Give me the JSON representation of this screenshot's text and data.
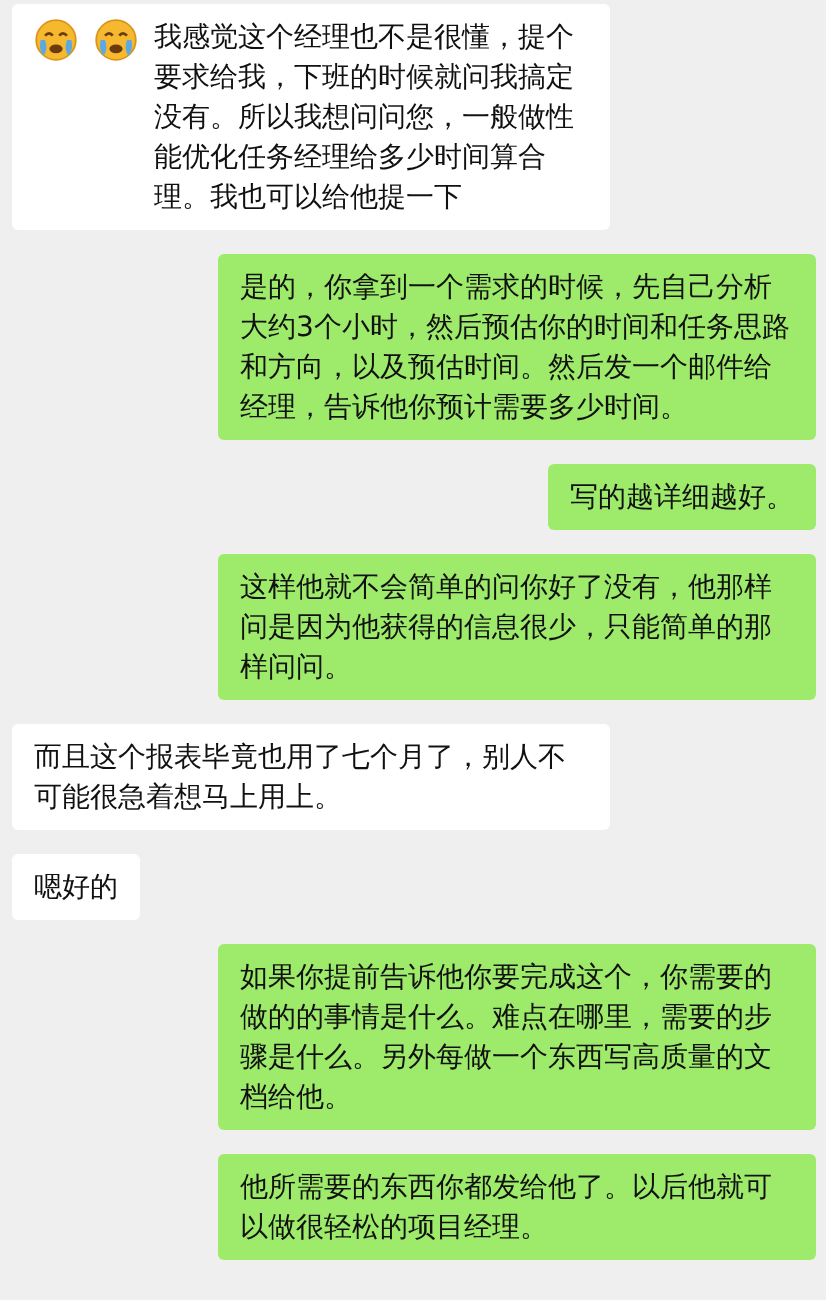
{
  "messages": [
    {
      "kind": "incoming",
      "emojis": [
        {
          "kind": "crying"
        },
        {
          "kind": "crying"
        }
      ],
      "text": "我感觉这个经理也不是很懂，提个要求给我，下班的时候就问我搞定没有。所以我想问问您，一般做性能优化任务经理给多少时间算合理。我也可以给他提一下"
    },
    {
      "kind": "outgoing",
      "text": "是的，你拿到一个需求的时候，先自己分析大约3个小时，然后预估你的时间和任务思路和方向，以及预估时间。然后发一个邮件给经理，告诉他你预计需要多少时间。"
    },
    {
      "kind": "outgoing",
      "text": "写的越详细越好。"
    },
    {
      "kind": "outgoing",
      "text": "这样他就不会简单的问你好了没有，他那样问是因为他获得的信息很少，只能简单的那样问问。"
    },
    {
      "kind": "incoming",
      "text": "而且这个报表毕竟也用了七个月了，别人不可能很急着想马上用上。"
    },
    {
      "kind": "incoming",
      "text": "嗯好的"
    },
    {
      "kind": "outgoing",
      "text": "如果你提前告诉他你要完成这个，你需要的做的的事情是什么。难点在哪里，需要的步骤是什么。另外每做一个东西写高质量的文档给他。"
    },
    {
      "kind": "outgoing",
      "text": "他所需要的东西你都发给他了。以后他就可以做很轻松的项目经理。"
    }
  ]
}
